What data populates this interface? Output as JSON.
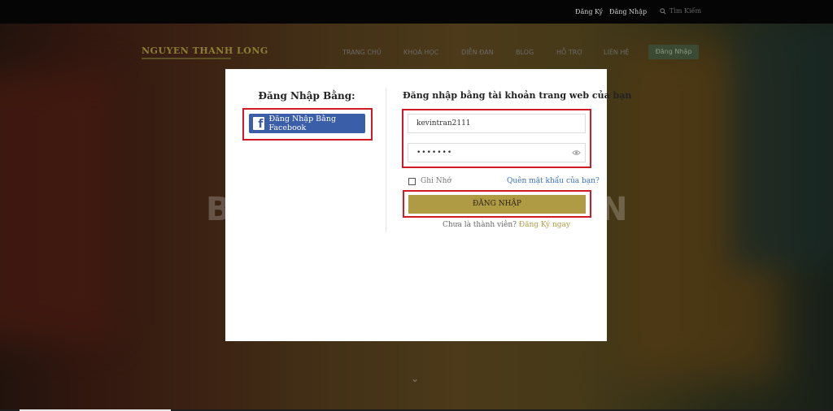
{
  "topbar": {
    "register": "Đăng Ký",
    "login": "Đăng Nhập",
    "search_placeholder": "Tìm Kiếm"
  },
  "header": {
    "logo": "NGUYEN THANH LONG",
    "nav": [
      "TRANG CHỦ",
      "KHOÁ HỌC",
      "DIỄN ĐÀN",
      "BLOG",
      "HỖ TRỢ",
      "LIÊN HỆ"
    ],
    "login_button": "Đăng Nhập"
  },
  "hero": {
    "left_letter": "B",
    "right_letter": "N",
    "scroll_icon": "chevron-down-icon"
  },
  "modal": {
    "left_title": "Đăng Nhập Bằng:",
    "facebook_button": "Đăng Nhập Bằng Facebook",
    "right_title": "Đăng nhập bằng tài khoản trang web của bạn",
    "username": "kevintran2111",
    "password_mask": "•••••••",
    "remember": "Ghi Nhớ",
    "forgot": "Quên mật khẩu của bạn?",
    "submit": "ĐĂNG NHẬP",
    "signup_prompt": "Chưa là thành viên?",
    "signup_link": "Đăng Ký ngay"
  },
  "colors": {
    "facebook": "#3a5ea7",
    "gold": "#b09b45",
    "highlight": "#d21a26",
    "link": "#3571b8"
  }
}
